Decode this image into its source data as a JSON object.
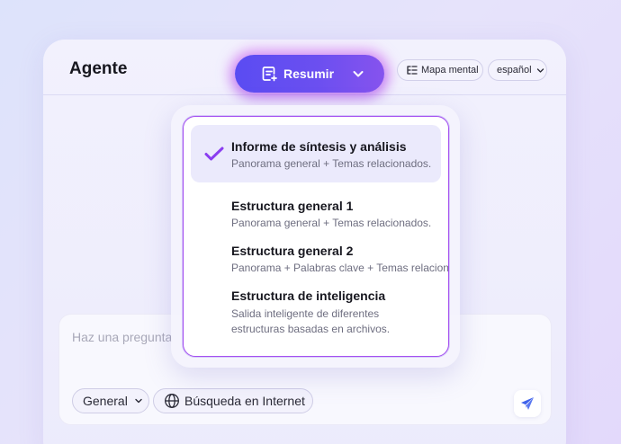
{
  "agent_panel": {
    "title": "Agente",
    "summarize_label": "Resumir",
    "mind_map_label": "Mapa mental",
    "language_label": "español"
  },
  "dropdown": {
    "options": [
      {
        "name": "Informe de síntesis y análisis",
        "desc": "Panorama general + Temas relacionados.",
        "selected": true
      },
      {
        "name": "Estructura general 1",
        "desc": "Panorama general + Temas relacionados.",
        "selected": false
      },
      {
        "name": "Estructura general 2",
        "desc": "Panorama + Palabras clave + Temas relacionados",
        "selected": false
      },
      {
        "name": "Estructura de inteligencia",
        "desc": "Salida inteligente de diferentes estructuras basadas en archivos.",
        "selected": false
      }
    ]
  },
  "composer": {
    "placeholder": "Haz una pregunta",
    "mode_label": "General",
    "web_search_label": "Búsqueda en Internet"
  },
  "icons": {
    "summarize": "document-sparkle-icon",
    "chevron": "chevron-down-icon",
    "mind_map": "mind-map-icon",
    "check": "check-icon",
    "globe": "globe-icon",
    "send": "send-icon"
  },
  "colors": {
    "accent": "#5a4cf2",
    "accent_end": "#8653ee",
    "glow": "#d65ff0",
    "dropdown_border": "#a54ff0",
    "selected_bg": "#ebeafc",
    "check": "#8a3df0"
  }
}
